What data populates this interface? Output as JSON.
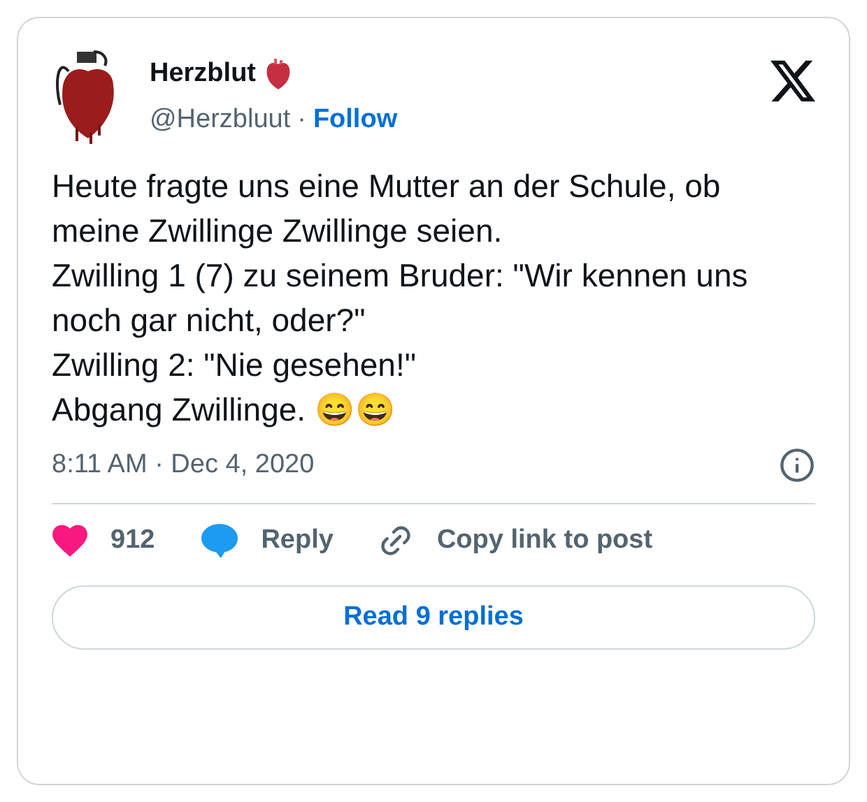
{
  "author": {
    "name": "Herzblut",
    "handle": "@Herzbluut",
    "separator": "·",
    "follow": "Follow"
  },
  "text": "Heute fragte uns eine Mutter an der Schule, ob meine Zwillinge Zwillinge seien.\nZwilling 1 (7) zu seinem Bruder: \"Wir kennen uns noch gar nicht, oder?\"\nZwilling 2: \"Nie gesehen!\"\nAbgang Zwillinge. 😄😄",
  "timestamp": "8:11 AM · Dec 4, 2020",
  "actions": [
    {
      "kind": "like",
      "label": "912"
    },
    {
      "kind": "reply",
      "label": "Reply"
    },
    {
      "kind": "copy",
      "label": "Copy link to post"
    }
  ],
  "read_replies": "Read 9 replies"
}
